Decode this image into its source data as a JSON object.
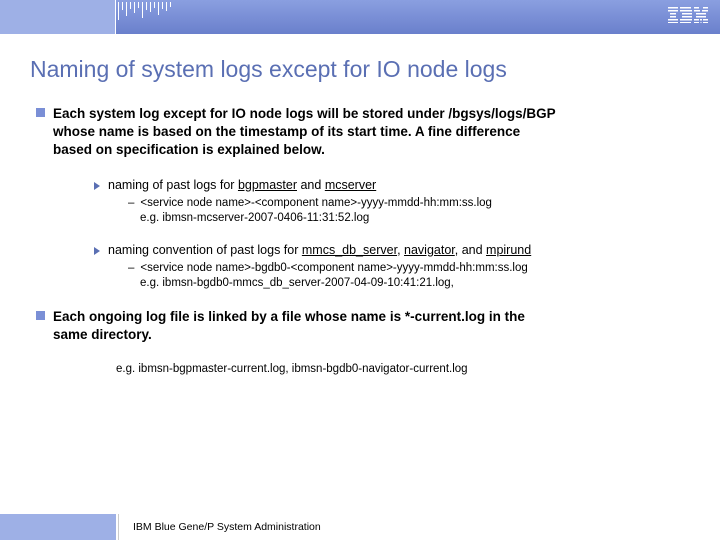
{
  "title": "Naming of system logs except for IO node logs",
  "p1a": "Each system log except for IO node logs will be stored under /bgsys/logs/BGP",
  "p1b": "whose name is based on the timestamp of its start time.  A fine difference",
  "p1c": "based on specification is explained below.",
  "s1_pre": "naming of past logs for ",
  "s1_u1": "bgpmaster",
  "s1_mid": " and ",
  "s1_u2": "mcserver",
  "d1": "<service node name>-<component name>-yyyy-mmdd-hh:mm:ss.log",
  "d1eg": "e.g. ibmsn-mcserver-2007-0406-11:31:52.log",
  "s2_pre": "naming convention of past logs for ",
  "s2_u1": "mmcs_db_server",
  "s2_c1": ", ",
  "s2_u2": "navigator",
  "s2_c2": ", and ",
  "s2_u3": "mpirund",
  "d2": "<service node name>-bgdb0-<component name>-yyyy-mmdd-hh:mm:ss.log",
  "d2eg": "e.g. ibmsn-bgdb0-mmcs_db_server-2007-04-09-10:41:21.log,",
  "p2a": "Each ongoing log file is linked by a file whose name is *-current.log in the",
  "p2b": "same directory.",
  "p2eg": "e.g. ibmsn-bgpmaster-current.log, ibmsn-bgdb0-navigator-current.log",
  "footer": "IBM Blue Gene/P System Administration"
}
